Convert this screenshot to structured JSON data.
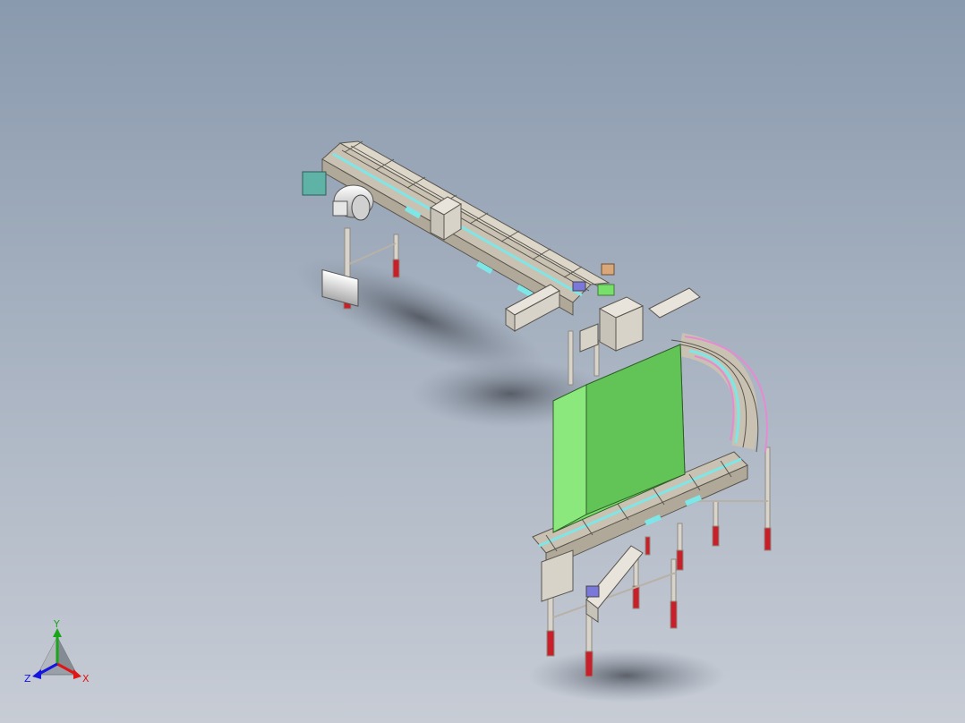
{
  "viewport": {
    "background_top": "#8a9aae",
    "background_bottom": "#c7ccd5"
  },
  "model": {
    "colors": {
      "frame_steel": "#c9c2b2",
      "frame_dark": "#8f8a80",
      "guard_green": "#78e06a",
      "guard_green_dark": "#4fae46",
      "belt_cyan": "#7fe6e8",
      "foot_red": "#c8202a",
      "motor_body": "#d9d9d9",
      "gearbox_teal": "#5fb3a6",
      "curve_pink": "#e58cd0"
    },
    "parts": [
      "straight-conveyor-section",
      "drive-motor",
      "electrical-box",
      "curved-conveyor-section",
      "safety-guard-panel",
      "support-legs",
      "lower-conveyor-section"
    ]
  },
  "triad": {
    "axis_y": "Y",
    "axis_x": "X",
    "axis_z": "Z",
    "color_y": "#1aa51a",
    "color_x": "#e01515",
    "color_z": "#1515e0"
  }
}
